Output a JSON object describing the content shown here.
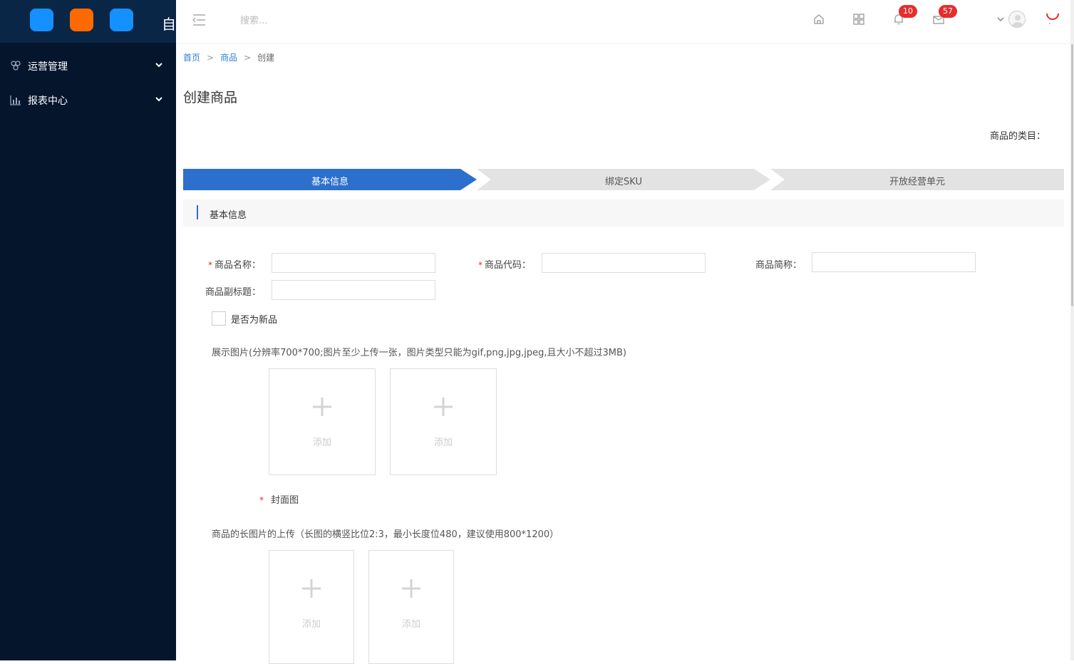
{
  "sidebar": {
    "logo_text": "自",
    "app_colors": [
      "#1591ff",
      "#ff6a00",
      "#1591ff"
    ],
    "items": [
      {
        "label": "运营管理",
        "icon": "cluster-icon"
      },
      {
        "label": "报表中心",
        "icon": "bar-chart-icon"
      }
    ]
  },
  "header": {
    "search_placeholder": "搜索...",
    "notifications_count": "10",
    "messages_count": "57"
  },
  "breadcrumb": {
    "home": "首页",
    "product": "商品",
    "current": "创建",
    "separator": ">"
  },
  "page": {
    "title": "创建商品",
    "category_label": "商品的类目："
  },
  "steps": [
    {
      "label": "基本信息",
      "active": true
    },
    {
      "label": "绑定SKU",
      "active": false
    },
    {
      "label": "开放经营单元",
      "active": false
    }
  ],
  "section": {
    "title": "基本信息"
  },
  "form": {
    "required_mark": "*",
    "name_label": "商品名称：",
    "code_label": "商品代码：",
    "short_label": "商品简称：",
    "subtitle_label": "商品副标题：",
    "is_new_label": "是否为新品"
  },
  "images": {
    "display_hint": "展示图片(分辨率700*700;图片至少上传一张，图片类型只能为gif,png,jpg,jpeg,且大小不超过3MB)",
    "add_label": "添加",
    "cover_label": "封面图",
    "long_hint": "商品的长图片的上传（长图的横竖比位2:3，最小长度位480，建议使用800*1200）"
  },
  "colors": {
    "accent": "#2d6fcc",
    "sidebar_bg": "#04152c",
    "badge": "#e52d2d"
  }
}
